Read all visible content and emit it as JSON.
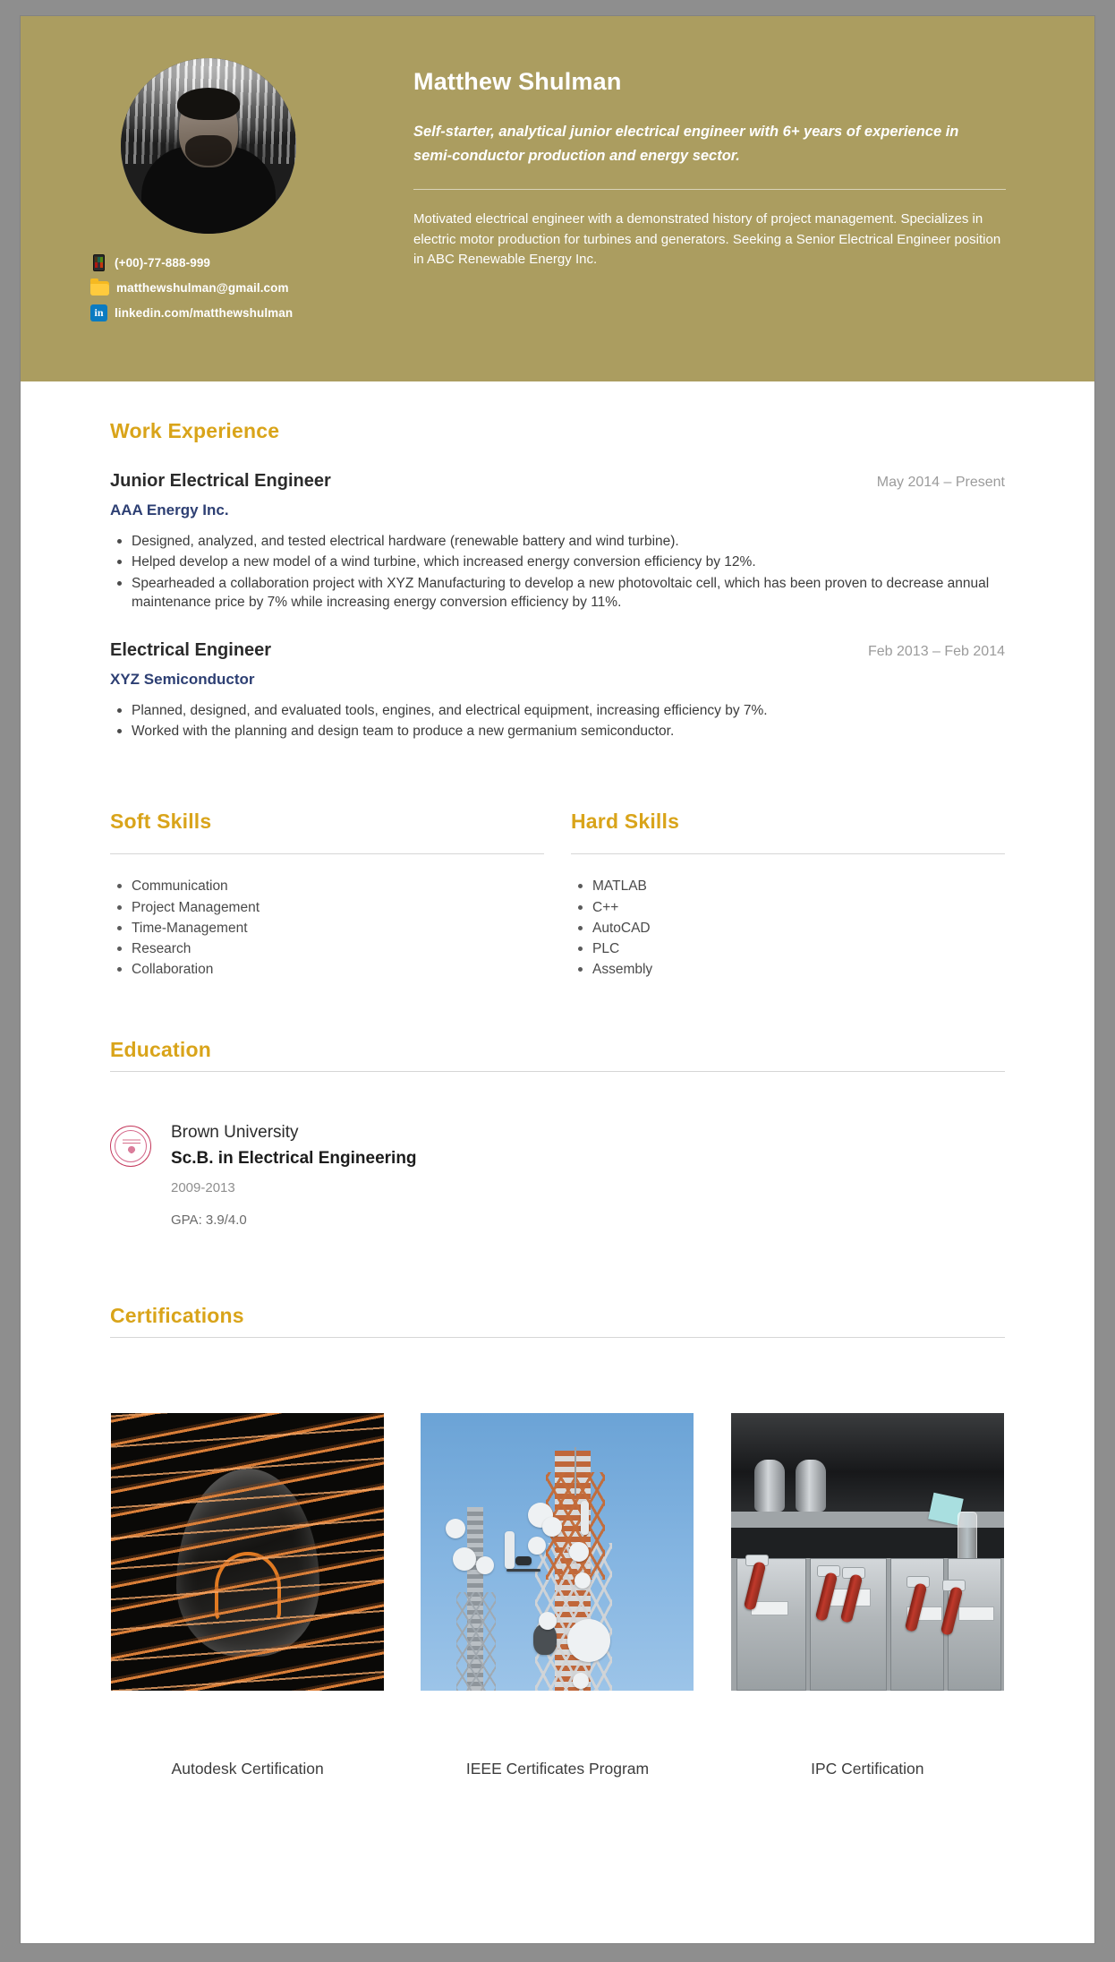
{
  "header": {
    "name": "Matthew Shulman",
    "tagline": "Self-starter, analytical junior electrical engineer with 6+ years of experience in semi-conductor production and energy sector.",
    "bio": "Motivated electrical engineer with a demonstrated history of project management. Specializes in electric motor production for turbines and generators. Seeking a Senior Electrical Engineer position in ABC Renewable Energy Inc.",
    "accent_color": "#ab9d60",
    "contacts": [
      {
        "icon": "phone-icon",
        "text": "(+00)-77-888-999"
      },
      {
        "icon": "email-folder-icon",
        "text": "matthewshulman@gmail.com"
      },
      {
        "icon": "linkedin-icon",
        "text": "linkedin.com/matthewshulman",
        "glyph": "in"
      }
    ]
  },
  "sections": {
    "work": {
      "title": "Work Experience",
      "jobs": [
        {
          "title": "Junior Electrical Engineer",
          "date": "May 2014 – Present",
          "company": "AAA Energy Inc.",
          "bullets": [
            "Designed, analyzed, and tested electrical hardware (renewable battery and wind turbine).",
            "Helped develop a new model of a wind turbine, which increased energy conversion efficiency by 12%.",
            "Spearheaded a collaboration project with XYZ Manufacturing to develop a new photovoltaic cell, which has been proven to decrease annual maintenance price by 7% while increasing energy conversion efficiency by 11%."
          ]
        },
        {
          "title": "Electrical Engineer",
          "date": "Feb 2013 – Feb 2014",
          "company": "XYZ Semiconductor",
          "bullets": [
            "Planned, designed, and evaluated tools, engines, and electrical equipment, increasing efficiency by 7%.",
            "Worked with the planning and design team to produce a new germanium semiconductor."
          ]
        }
      ]
    },
    "soft_skills": {
      "title": "Soft Skills",
      "items": [
        "Communication",
        "Project Management",
        "Time-Management",
        "Research",
        "Collaboration"
      ]
    },
    "hard_skills": {
      "title": "Hard Skills",
      "items": [
        "MATLAB",
        "C++",
        "AutoCAD",
        "PLC",
        "Assembly"
      ]
    },
    "education": {
      "title": "Education",
      "entries": [
        {
          "school": "Brown University",
          "degree": "Sc.B. in Electrical Engineering",
          "years": "2009-2013",
          "gpa": "GPA: 3.9/4.0",
          "seal": "university-seal-icon"
        }
      ]
    },
    "certifications": {
      "title": "Certifications",
      "items": [
        {
          "caption": "Autodesk Certification",
          "image": "copper-wires-lightbulb-photo"
        },
        {
          "caption": "IEEE Certificates Program",
          "image": "cell-tower-photo"
        },
        {
          "caption": "IPC Certification",
          "image": "electrical-switchgear-photo"
        }
      ]
    }
  },
  "theme": {
    "heading_color": "#d9a41a",
    "company_color": "#2d3f73",
    "date_color": "#9b9b9b",
    "page_background": "#8e8e8e",
    "paper_background": "#ffffff"
  }
}
